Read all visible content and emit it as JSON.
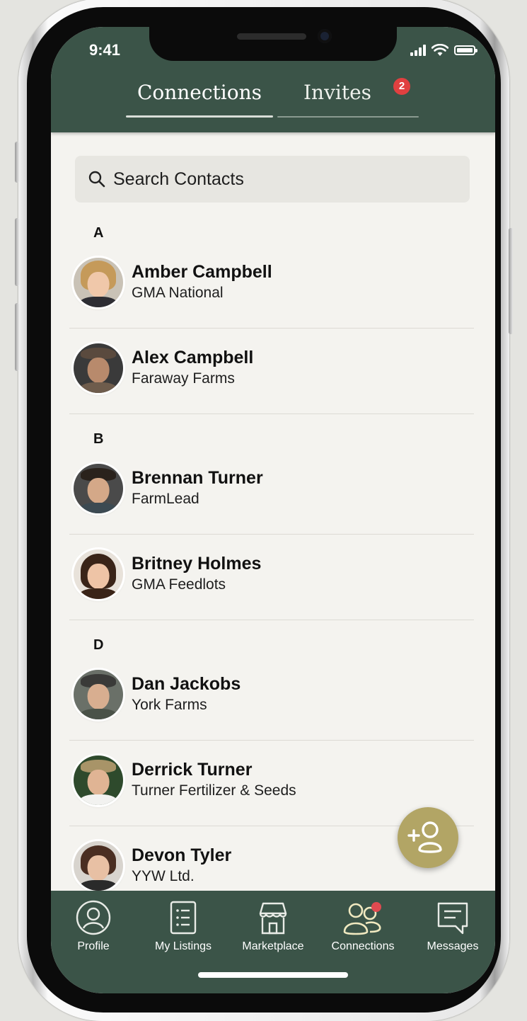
{
  "status_bar": {
    "time": "9:41"
  },
  "tabs": {
    "connections": "Connections",
    "invites": "Invites",
    "invites_badge": "2"
  },
  "search": {
    "placeholder": "Search Contacts"
  },
  "sections": [
    {
      "letter": "A"
    },
    {
      "letter": "B"
    },
    {
      "letter": "D"
    }
  ],
  "contacts": [
    {
      "name": "Amber Campbell",
      "org": "GMA National"
    },
    {
      "name": "Alex Campbell",
      "org": "Faraway Farms"
    },
    {
      "name": "Brennan Turner",
      "org": "FarmLead"
    },
    {
      "name": "Britney Holmes",
      "org": "GMA Feedlots"
    },
    {
      "name": "Dan Jackobs",
      "org": "York Farms"
    },
    {
      "name": "Derrick Turner",
      "org": "Turner Fertilizer & Seeds"
    },
    {
      "name": "Devon Tyler",
      "org": "YYW Ltd."
    }
  ],
  "bottom_nav": [
    {
      "label": "Profile",
      "icon": "profile-icon"
    },
    {
      "label": "My Listings",
      "icon": "listings-icon"
    },
    {
      "label": "Marketplace",
      "icon": "marketplace-icon"
    },
    {
      "label": "Connections",
      "icon": "connections-icon"
    },
    {
      "label": "Messages",
      "icon": "messages-icon"
    }
  ],
  "colors": {
    "header": "#3b5448",
    "fab": "#b2a565",
    "badge": "#e04040",
    "background": "#f4f3ef"
  }
}
